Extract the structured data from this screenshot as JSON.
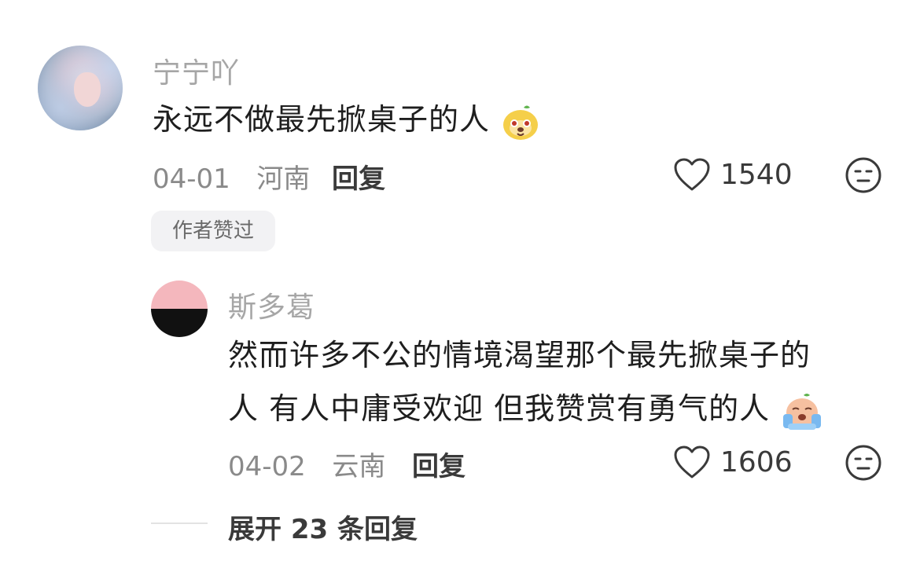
{
  "comment": {
    "username": "宁宁吖",
    "text": "永远不做最先掀桌子的人",
    "emoji": "dog-emoji",
    "date": "04-01",
    "location": "河南",
    "reply_label": "回复",
    "likes": "1540",
    "badge": "作者赞过"
  },
  "reply": {
    "username": "斯多葛",
    "text_line1": "然而许多不公的情境渴望那个最先掀桌子的",
    "text_line2": "人 有人中庸受欢迎 但我赞赏有勇气的人",
    "emoji": "crying-emoji",
    "date": "04-02",
    "location": "云南",
    "reply_label": "回复",
    "likes": "1606"
  },
  "expand_label": "展开 23 条回复"
}
